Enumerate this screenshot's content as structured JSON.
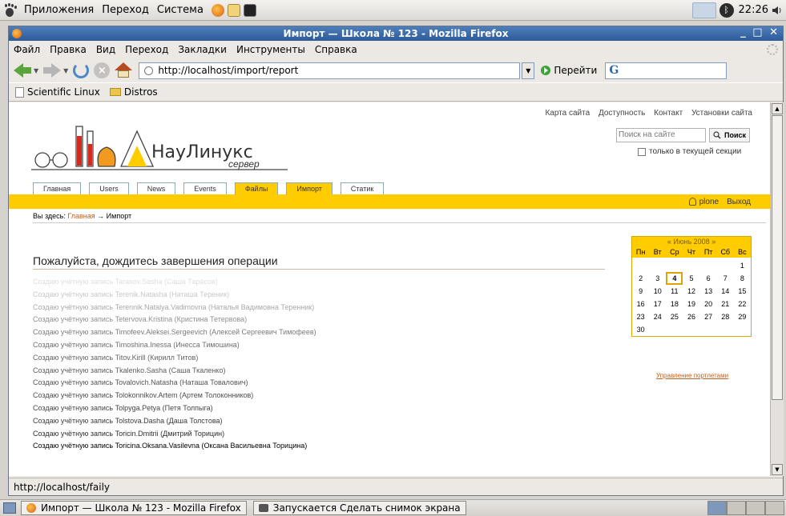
{
  "top_panel": {
    "menu": [
      "Приложения",
      "Переход",
      "Система"
    ],
    "clock": "22:26"
  },
  "window": {
    "title": "Импорт — Школа № 123 - Mozilla Firefox",
    "controls": "_ □ ✕"
  },
  "menubar": [
    "Файл",
    "Правка",
    "Вид",
    "Переход",
    "Закладки",
    "Инструменты",
    "Справка"
  ],
  "navbar": {
    "url": "http://localhost/import/report",
    "go_label": "Перейти",
    "search_engine_icon": "G"
  },
  "bookmarks": [
    "Scientific Linux",
    "Distros"
  ],
  "site": {
    "site_actions": [
      "Карта сайта",
      "Доступность",
      "Контакт",
      "Установки сайта"
    ],
    "logo_text": "НауЛинукс",
    "logo_sub": "сервер",
    "search_placeholder": "Поиск на сайте",
    "search_button": "Поиск",
    "search_section_label": "только в текущей секции",
    "tabs": [
      "Главная",
      "Users",
      "News",
      "Events",
      "Файлы",
      "Импорт",
      "Статик"
    ],
    "selected_tabs": [
      4,
      5
    ],
    "user_name": "plone",
    "logout": "Выход",
    "breadcrumb_prefix": "Вы здесь:",
    "breadcrumb_home": "Главная",
    "breadcrumb_arrow": "→",
    "breadcrumb_current": "Импорт",
    "heading": "Пожалуйста, дождитесь завершения операции",
    "log_lines": [
      {
        "text": "Создаю учётную запись Tarasov.Sasha (Саша Тарасов)",
        "color": "#dddddd"
      },
      {
        "text": "Создаю учётную запись Terenik.Natasha (Наташа Тереник)",
        "color": "#c8c8c8"
      },
      {
        "text": "Создаю учётную запись Terennik.Natalya.Vadimovna (Наталья Вадимовна Теренник)",
        "color": "#a8a8a8"
      },
      {
        "text": "Создаю учётную запись Tetervova.Kristina (Кристина Тетервова)",
        "color": "#8f8f8f"
      },
      {
        "text": "Создаю учётную запись Timofeev.Aleksei.Sergeevich (Алексей Сергеевич Тимофеев)",
        "color": "#7b7b7b"
      },
      {
        "text": "Создаю учётную запись Timoshina.Inessa (Инесса Тимошина)",
        "color": "#6e6e6e"
      },
      {
        "text": "Создаю учётную запись Titov.Kirill (Кирилл Титов)",
        "color": "#646464"
      },
      {
        "text": "Создаю учётную запись Tkalenko.Sasha (Саша Ткаленко)",
        "color": "#5c5c5c"
      },
      {
        "text": "Создаю учётную запись Tovalovich.Natasha (Наташа Товалович)",
        "color": "#545454"
      },
      {
        "text": "Создаю учётную запись Tolokonnikov.Artem (Артем Толоконников)",
        "color": "#4c4c4c"
      },
      {
        "text": "Создаю учётную запись Tolpyga.Petya (Петя Толпыга)",
        "color": "#444444"
      },
      {
        "text": "Создаю учётную запись Tolstova.Dasha (Даша Толстова)",
        "color": "#3a3a3a"
      },
      {
        "text": "Создаю учётную запись Toricin.Dmitrii (Дмитрий Торицин)",
        "color": "#2c2c2c"
      },
      {
        "text": "Создаю учётную запись Toricina.Oksana.Vasilevna (Оксана Васильевна Торицина)",
        "color": "#000000"
      }
    ],
    "calendar": {
      "header": "« Июнь 2008 »",
      "weekdays": [
        "Пн",
        "Вт",
        "Ср",
        "Чт",
        "Пт",
        "Сб",
        "Вс"
      ],
      "leading_blanks": 6,
      "days": [
        "1",
        "2",
        "3",
        "4",
        "5",
        "6",
        "7",
        "8",
        "9",
        "10",
        "11",
        "12",
        "13",
        "14",
        "15",
        "16",
        "17",
        "18",
        "19",
        "20",
        "21",
        "22",
        "23",
        "24",
        "25",
        "26",
        "27",
        "28",
        "29",
        "30"
      ],
      "today": "4"
    },
    "portlet_manage": "Управление портлетами"
  },
  "statusbar": "http://localhost/faily",
  "taskbar": {
    "tasks": [
      "Импорт — Школа № 123 - Mozilla Firefox",
      "Запускается Сделать снимок экрана"
    ]
  },
  "colors": {
    "accent_yellow": "#ffcc00",
    "link_orange": "#c55e1a",
    "title_blue": "#2d5a9a"
  }
}
